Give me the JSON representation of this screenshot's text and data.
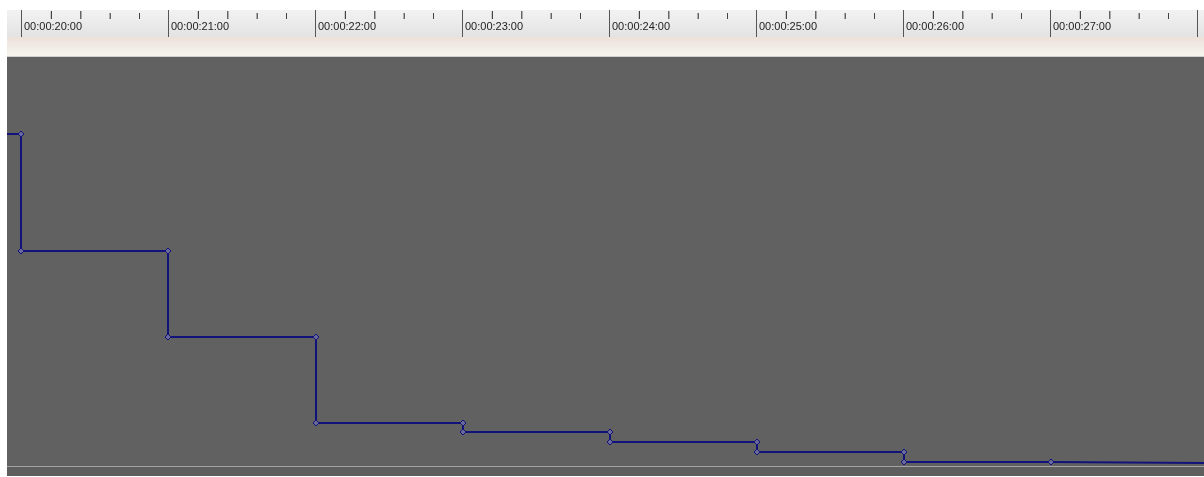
{
  "ruler": {
    "labels": [
      "00:00:20:00",
      "00:00:21:00",
      "00:00:22:00",
      "00:00:23:00",
      "00:00:24:00",
      "00:00:25:00",
      "00:00:26:00",
      "00:00:27:00"
    ]
  }
}
